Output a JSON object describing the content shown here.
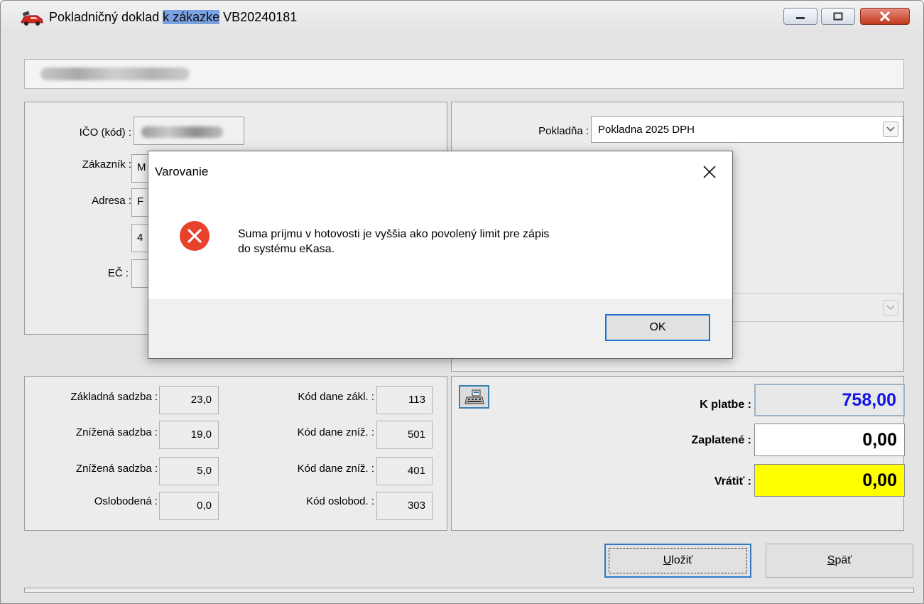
{
  "window": {
    "title_start": "Pokladničný doklad ",
    "title_highlight": "k zákazke",
    "title_end": " VB20240181"
  },
  "customer": {
    "ico_label": "IČO  (kód) :",
    "customer_label": "Zákazník :",
    "customer_value_prefix": "M",
    "address_label": "Adresa :",
    "address_value_prefix": "F",
    "address2_value_prefix": "4",
    "ec_label": "EČ :"
  },
  "cash_register": {
    "label": "Pokladňa :",
    "value": "Pokladna 2025 DPH"
  },
  "tax": {
    "rows": [
      {
        "rate_label": "Základná sadzba :",
        "rate_value": "23,0",
        "code_label": "Kód dane zákl. :",
        "code_value": "113"
      },
      {
        "rate_label": "Znížená sadzba :",
        "rate_value": "19,0",
        "code_label": "Kód dane zníž. :",
        "code_value": "501"
      },
      {
        "rate_label": "Znížená sadzba :",
        "rate_value": "5,0",
        "code_label": "Kód dane zníž. :",
        "code_value": "401"
      },
      {
        "rate_label": "Oslobodená  :",
        "rate_value": "0,0",
        "code_label": "Kód oslobod. :",
        "code_value": "303"
      }
    ]
  },
  "payment": {
    "due_label": "K platbe :",
    "due_value": "758,00",
    "paid_label": "Zaplatené :",
    "paid_value": "0,00",
    "change_label": "Vrátiť :",
    "change_value": "0,00",
    "colors": {
      "due_text": "#1414e6",
      "change_bg": "#ffff00"
    }
  },
  "buttons": {
    "save_label_u": "U",
    "save_label_rest": "ložiť",
    "back_label_u": "S",
    "back_label_rest": "päť"
  },
  "dialog": {
    "title": "Varovanie",
    "message_line1": "Suma príjmu v hotovosti je vyššia ako povolený limit pre zápis",
    "message_line2": "do systému eKasa.",
    "ok_label": "OK",
    "icon": "error-icon",
    "colors": {
      "error": "#e8412c"
    }
  }
}
